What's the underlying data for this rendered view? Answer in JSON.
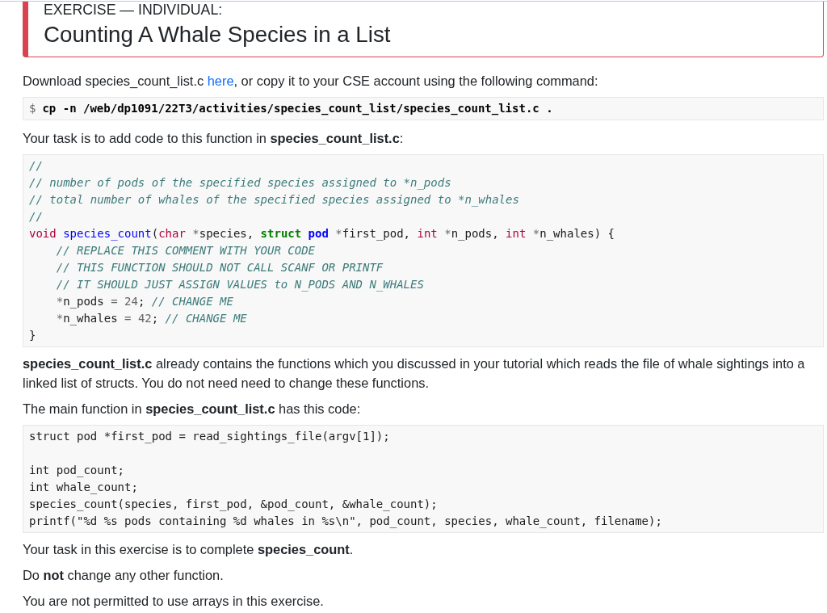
{
  "exercise": {
    "label": "EXERCISE — INDIVIDUAL:",
    "title": "Counting A Whale Species in a List"
  },
  "blocks": [
    {
      "kind": "link_paragraph",
      "before": "Download species_count_list.c ",
      "link": "here",
      "after": ", or copy it to your CSE account using the following command:"
    },
    {
      "kind": "command",
      "prompt": "$",
      "command": "cp -n /web/dp1091/22T3/activities/species_count_list/species_count_list.c ."
    },
    {
      "kind": "paragraph",
      "text": "Your task is to add code to this function in **species_count_list.c**:"
    },
    {
      "kind": "code",
      "lines": [
        {
          "kind": "code",
          "tokens": [
            {
              "kind": "comment",
              "text": "//"
            }
          ]
        },
        {
          "kind": "code",
          "tokens": [
            {
              "kind": "comment",
              "text": "// number of pods of the specified species assigned to *n_pods"
            }
          ]
        },
        {
          "kind": "code",
          "tokens": [
            {
              "kind": "comment",
              "text": "// total number of whales of the specified species assigned to *n_whales"
            }
          ]
        },
        {
          "kind": "code",
          "tokens": [
            {
              "kind": "comment",
              "text": "//"
            }
          ]
        },
        {
          "kind": "code",
          "tokens": [
            {
              "kind": "type",
              "text": "void"
            },
            {
              "kind": "func",
              "text": " species_count"
            },
            {
              "kind": "plain",
              "text": "("
            },
            {
              "kind": "type",
              "text": "char"
            },
            {
              "kind": "op",
              "text": " *"
            },
            {
              "kind": "plain",
              "text": "species, "
            },
            {
              "kind": "keyword",
              "text": "struct"
            },
            {
              "kind": "class",
              "text": " pod"
            },
            {
              "kind": "op",
              "text": " *"
            },
            {
              "kind": "plain",
              "text": "first_pod, "
            },
            {
              "kind": "type",
              "text": "int"
            },
            {
              "kind": "op",
              "text": " *"
            },
            {
              "kind": "plain",
              "text": "n_pods, "
            },
            {
              "kind": "type",
              "text": "int"
            },
            {
              "kind": "op",
              "text": " *"
            },
            {
              "kind": "plain",
              "text": "n_whales) {"
            }
          ]
        },
        {
          "kind": "code",
          "tokens": [
            {
              "kind": "comment",
              "text": "    // REPLACE THIS COMMENT WITH YOUR CODE"
            }
          ]
        },
        {
          "kind": "code",
          "tokens": [
            {
              "kind": "comment",
              "text": "    // THIS FUNCTION SHOULD NOT CALL SCANF OR PRINTF"
            }
          ]
        },
        {
          "kind": "code",
          "tokens": [
            {
              "kind": "comment",
              "text": "    // IT SHOULD JUST ASSIGN VALUES to N_PODS AND N_WHALES"
            }
          ]
        },
        {
          "kind": "code",
          "tokens": [
            {
              "kind": "op",
              "text": "    *"
            },
            {
              "kind": "plain",
              "text": "n_pods "
            },
            {
              "kind": "op",
              "text": "="
            },
            {
              "kind": "number",
              "text": " 24"
            },
            {
              "kind": "plain",
              "text": "; "
            },
            {
              "kind": "comment",
              "text": "// CHANGE ME"
            }
          ]
        },
        {
          "kind": "code",
          "tokens": [
            {
              "kind": "op",
              "text": "    *"
            },
            {
              "kind": "plain",
              "text": "n_whales "
            },
            {
              "kind": "op",
              "text": "="
            },
            {
              "kind": "number",
              "text": " 42"
            },
            {
              "kind": "plain",
              "text": "; "
            },
            {
              "kind": "comment",
              "text": "// CHANGE ME"
            }
          ]
        },
        {
          "kind": "code",
          "tokens": [
            {
              "kind": "plain",
              "text": "}"
            }
          ]
        }
      ]
    },
    {
      "kind": "paragraph",
      "text": "**species_count_list.c** already contains the functions which you discussed in your tutorial which reads the file of whale sightings into a linked list of structs. You do not need need to change these functions."
    },
    {
      "kind": "paragraph",
      "text": "The main function in **species_count_list.c** has this code:"
    },
    {
      "kind": "code",
      "lines": [
        {
          "kind": "code",
          "tokens": [
            {
              "kind": "plain",
              "text": "struct pod *first_pod = read_sightings_file(argv[1]);"
            }
          ]
        },
        {
          "kind": "blank"
        },
        {
          "kind": "code",
          "tokens": [
            {
              "kind": "plain",
              "text": "int pod_count;"
            }
          ]
        },
        {
          "kind": "code",
          "tokens": [
            {
              "kind": "plain",
              "text": "int whale_count;"
            }
          ]
        },
        {
          "kind": "code",
          "tokens": [
            {
              "kind": "plain",
              "text": "species_count(species, first_pod, &pod_count, &whale_count);"
            }
          ]
        },
        {
          "kind": "code",
          "tokens": [
            {
              "kind": "plain",
              "text": "printf(\"%d %s pods containing %d whales in %s\\n\", pod_count, species, whale_count, filename);"
            }
          ]
        }
      ]
    },
    {
      "kind": "paragraph",
      "text": "Your task in this exercise is to complete **species_count**."
    },
    {
      "kind": "paragraph",
      "text": "Do **not** change any other function."
    },
    {
      "kind": "paragraph",
      "text": "You are not permitted to use arrays in this exercise."
    }
  ]
}
